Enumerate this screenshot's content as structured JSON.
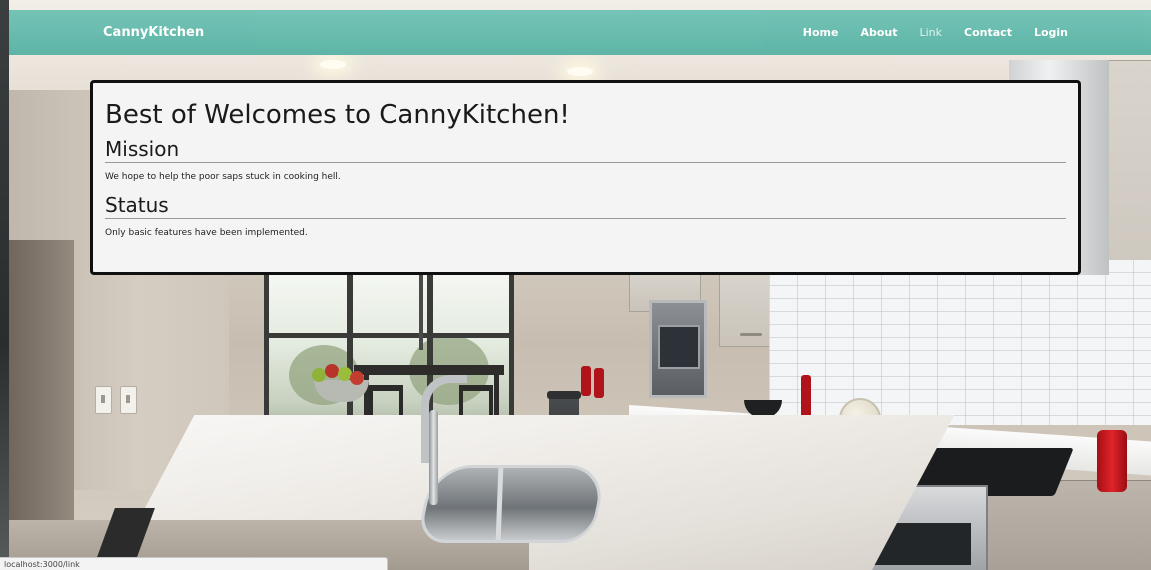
{
  "navbar": {
    "brand": "CannyKitchen",
    "items": [
      {
        "label": "Home"
      },
      {
        "label": "About"
      },
      {
        "label": "Link"
      },
      {
        "label": "Contact"
      },
      {
        "label": "Login"
      }
    ],
    "color": "#5fb8a9"
  },
  "content": {
    "title": "Best of Welcomes to CannyKitchen!",
    "sections": [
      {
        "heading": "Mission",
        "text": "We hope to help the poor saps stuck in cooking hell."
      },
      {
        "heading": "Status",
        "text": "Only basic features have been implemented."
      }
    ]
  },
  "status_bar": {
    "url": "localhost:3000/link"
  },
  "background": {
    "subject": "kitchen-photo"
  }
}
